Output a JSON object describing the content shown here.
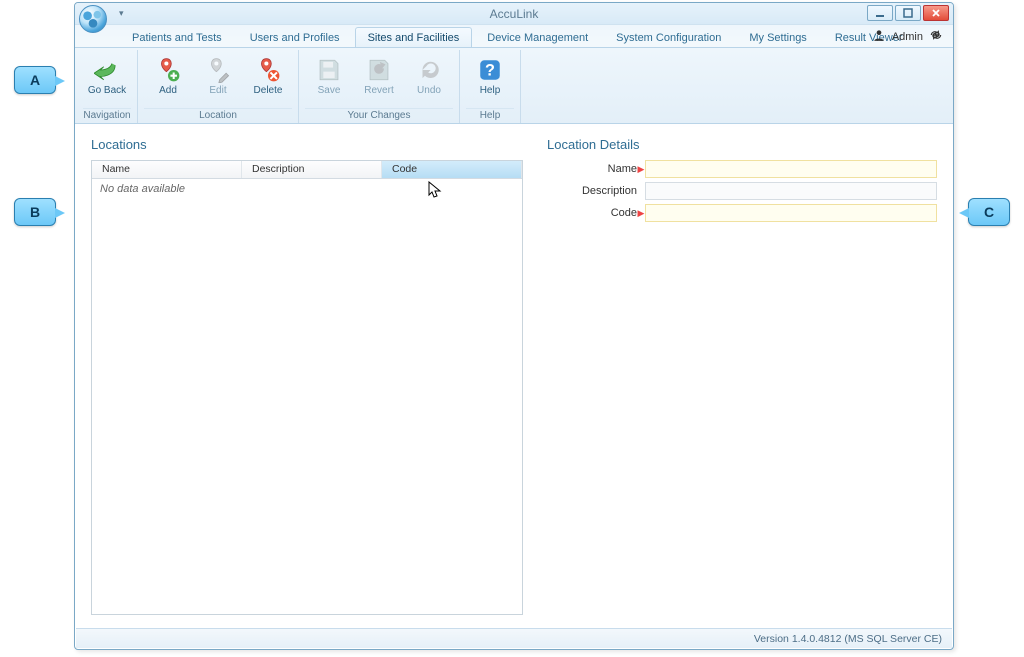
{
  "app": {
    "title": "AccuLink"
  },
  "tabs": [
    {
      "label": "Patients and Tests",
      "active": false
    },
    {
      "label": "Users and Profiles",
      "active": false
    },
    {
      "label": "Sites and Facilities",
      "active": true
    },
    {
      "label": "Device Management",
      "active": false
    },
    {
      "label": "System Configuration",
      "active": false
    },
    {
      "label": "My Settings",
      "active": false
    },
    {
      "label": "Result Viewer",
      "active": false
    }
  ],
  "user": {
    "name": "Admin"
  },
  "ribbon": {
    "groups": [
      {
        "label": "Navigation",
        "buttons": [
          {
            "key": "go-back",
            "label": "Go Back",
            "enabled": true
          }
        ]
      },
      {
        "label": "Location",
        "buttons": [
          {
            "key": "add",
            "label": "Add",
            "enabled": true
          },
          {
            "key": "edit",
            "label": "Edit",
            "enabled": false
          },
          {
            "key": "delete",
            "label": "Delete",
            "enabled": true
          }
        ]
      },
      {
        "label": "Your Changes",
        "buttons": [
          {
            "key": "save",
            "label": "Save",
            "enabled": false
          },
          {
            "key": "revert",
            "label": "Revert",
            "enabled": false
          },
          {
            "key": "undo",
            "label": "Undo",
            "enabled": false
          }
        ]
      },
      {
        "label": "Help",
        "buttons": [
          {
            "key": "help",
            "label": "Help",
            "enabled": true
          }
        ]
      }
    ]
  },
  "locations_panel": {
    "title": "Locations",
    "columns": [
      "Name",
      "Description",
      "Code"
    ],
    "sorted_column_index": 2,
    "empty_text": "No data available"
  },
  "details_panel": {
    "title": "Location Details",
    "fields": [
      {
        "key": "name",
        "label": "Name",
        "required": true,
        "value": ""
      },
      {
        "key": "description",
        "label": "Description",
        "required": false,
        "value": ""
      },
      {
        "key": "code",
        "label": "Code",
        "required": true,
        "value": ""
      }
    ]
  },
  "status": {
    "version_text": "Version 1.4.0.4812 (MS SQL Server CE)"
  },
  "callouts": {
    "A": "A",
    "B": "B",
    "C": "C"
  }
}
